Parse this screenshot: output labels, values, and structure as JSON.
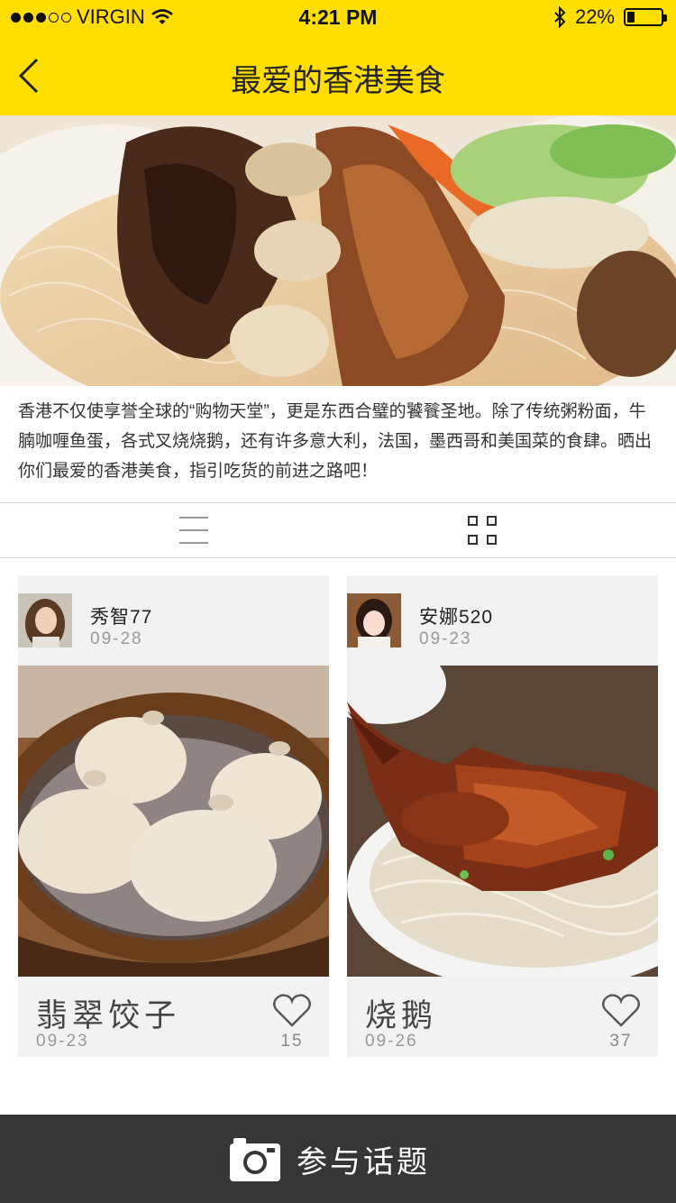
{
  "status_bar": {
    "carrier": "VIRGIN",
    "signal_bars": 3,
    "signal_total": 5,
    "time": "4:21 PM",
    "battery_text": "22%",
    "battery_level": 0.22
  },
  "nav": {
    "back_icon": "chevron-left-icon",
    "title": "最爱的香港美食"
  },
  "topic": {
    "description": "香港不仅使享誉全球的“购物天堂”，更是东西合璧的饕餮圣地。除了传统粥粉面，牛腩咖喱鱼蛋，各式叉烧烧鹅，还有许多意大利，法国，墨西哥和美国菜的食肆。晒出你们最爱的香港美食，指引吃货的前进之路吧！"
  },
  "view_toggle": {
    "list_icon": "list-view-icon",
    "grid_icon": "grid-view-icon"
  },
  "posts": [
    {
      "user": "秀智77",
      "user_date": "09-28",
      "dish": "翡翠饺子",
      "dish_date": "09-23",
      "likes": "15"
    },
    {
      "user": "安娜520",
      "user_date": "09-23",
      "dish": "烧鹅",
      "dish_date": "09-26",
      "likes": "37"
    }
  ],
  "bottom": {
    "join_label": "参与话题",
    "camera_icon": "camera-icon"
  },
  "colors": {
    "header": "#ffde00",
    "bottom_bar": "#363636",
    "card_bg": "#f2f2f2"
  }
}
